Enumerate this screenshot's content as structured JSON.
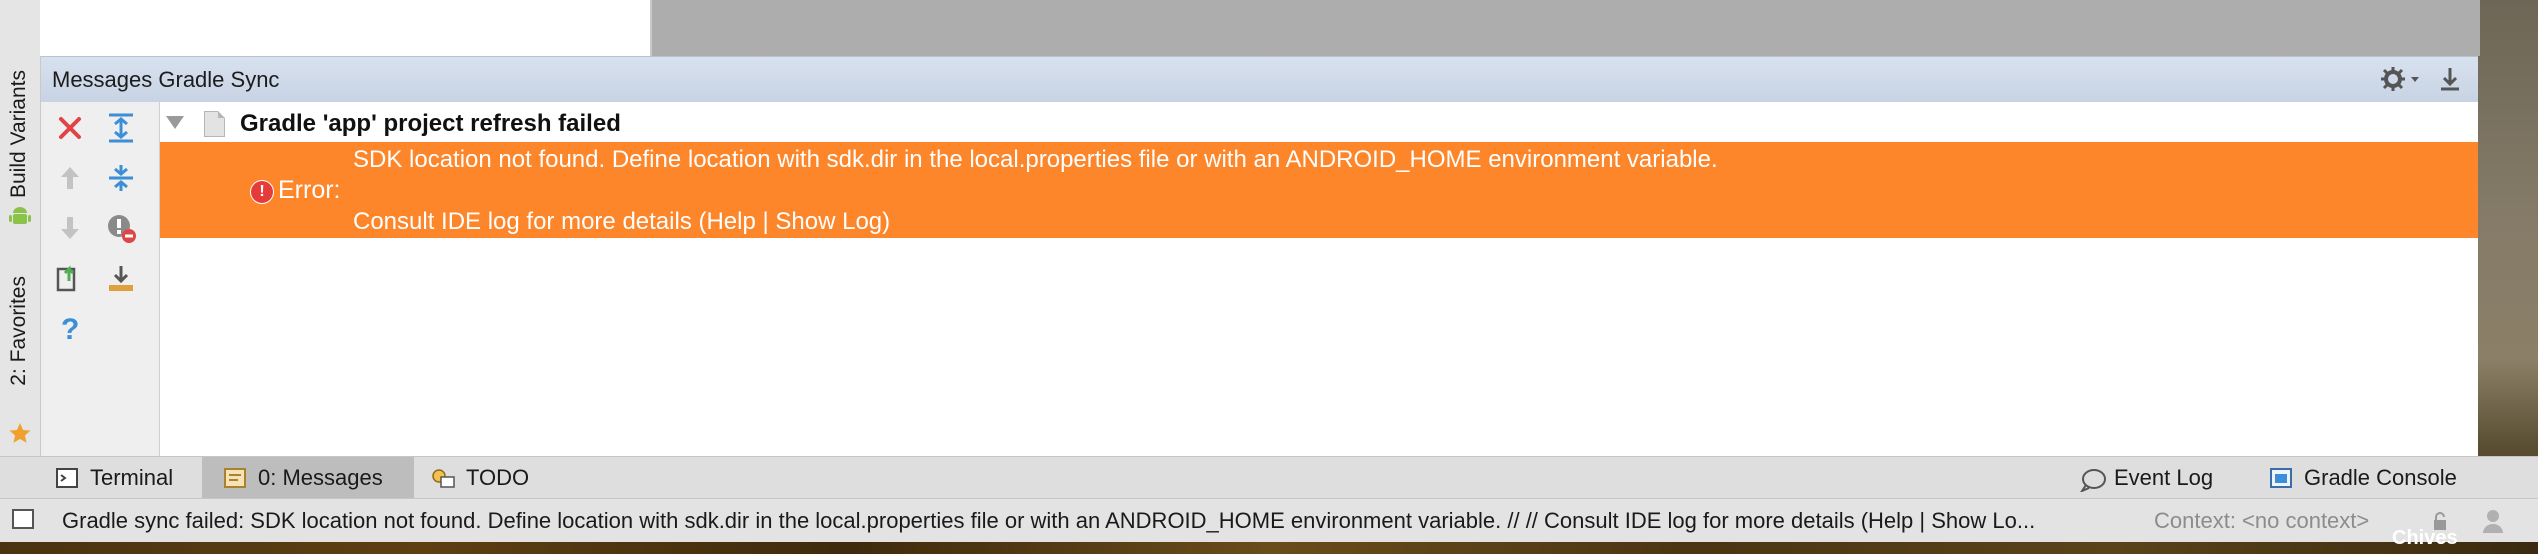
{
  "panel": {
    "title": "Messages Gradle Sync"
  },
  "side_tabs": {
    "build_variants": "Build Variants",
    "favorites": "2: Favorites"
  },
  "tree": {
    "root_label": "Gradle 'app' project refresh failed",
    "error": {
      "label": "Error:",
      "line1": "SDK location not found. Define location with sdk.dir in the local.properties file or with an ANDROID_HOME environment variable.",
      "line2": "Consult IDE log for more details (Help | Show Log)"
    }
  },
  "toolbar": {
    "icons": [
      "close-icon",
      "expand-all-icon",
      "previous-icon",
      "collapse-all-icon",
      "next-icon",
      "filter-errors-icon",
      "export-icon",
      "download-icon",
      "help-icon"
    ]
  },
  "tool_tabs": {
    "terminal": "Terminal",
    "messages": "0: Messages",
    "todo": "TODO",
    "event_log": "Event Log",
    "gradle_console": "Gradle Console"
  },
  "status_bar": {
    "message": "Gradle sync failed: SDK location not found. Define location with sdk.dir in the local.properties file or with an ANDROID_HOME environment variable. // // Consult IDE log for more details (Help | Show Lo...",
    "context": "Context: <no context>"
  },
  "desktop": {
    "partial_label": "Chives"
  },
  "colors": {
    "error_row": "#fd852a",
    "header": "#c7d3e4",
    "close_red": "#e04545",
    "accent_blue": "#3a8fd6"
  }
}
